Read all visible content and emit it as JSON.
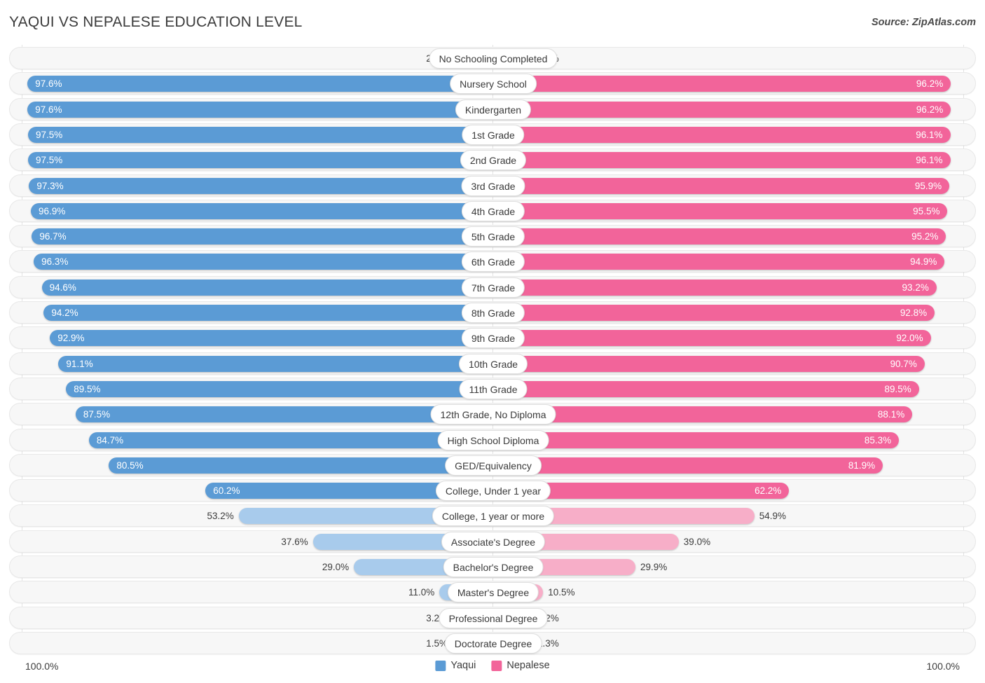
{
  "header": {
    "title": "YAQUI VS NEPALESE EDUCATION LEVEL",
    "source": "Source: ZipAtlas.com"
  },
  "axis": {
    "left_max_label": "100.0%",
    "right_max_label": "100.0%"
  },
  "legend": {
    "items": [
      {
        "label": "Yaqui",
        "color": "#5B9BD5"
      },
      {
        "label": "Nepalese",
        "color": "#F2649A"
      }
    ]
  },
  "colors": {
    "blue_strong": "#5B9BD5",
    "blue_light": "#A8CBEC",
    "pink_strong": "#F2649A",
    "pink_light": "#F7AEC8",
    "track": "#f7f7f7",
    "track_border": "#e8e8e8"
  },
  "chart_data": {
    "type": "bar",
    "orientation": "horizontal-diverging",
    "title": "YAQUI VS NEPALESE EDUCATION LEVEL",
    "xlabel": "",
    "ylabel": "",
    "xlim": [
      0,
      100
    ],
    "grid": false,
    "legend_position": "bottom-center",
    "categories": [
      "No Schooling Completed",
      "Nursery School",
      "Kindergarten",
      "1st Grade",
      "2nd Grade",
      "3rd Grade",
      "4th Grade",
      "5th Grade",
      "6th Grade",
      "7th Grade",
      "8th Grade",
      "9th Grade",
      "10th Grade",
      "11th Grade",
      "12th Grade, No Diploma",
      "High School Diploma",
      "GED/Equivalency",
      "College, Under 1 year",
      "College, 1 year or more",
      "Associate's Degree",
      "Bachelor's Degree",
      "Master's Degree",
      "Professional Degree",
      "Doctorate Degree"
    ],
    "series": [
      {
        "name": "Yaqui",
        "side": "left",
        "color": "#5B9BD5",
        "values": [
          2.4,
          97.6,
          97.6,
          97.5,
          97.5,
          97.3,
          96.9,
          96.7,
          96.3,
          94.6,
          94.2,
          92.9,
          91.1,
          89.5,
          87.5,
          84.7,
          80.5,
          60.2,
          53.2,
          37.6,
          29.0,
          11.0,
          3.2,
          1.5
        ],
        "labels": [
          "2.4%",
          "97.6%",
          "97.6%",
          "97.5%",
          "97.5%",
          "97.3%",
          "96.9%",
          "96.7%",
          "96.3%",
          "94.6%",
          "94.2%",
          "92.9%",
          "91.1%",
          "89.5%",
          "87.5%",
          "84.7%",
          "80.5%",
          "60.2%",
          "53.2%",
          "37.6%",
          "29.0%",
          "11.0%",
          "3.2%",
          "1.5%"
        ]
      },
      {
        "name": "Nepalese",
        "side": "right",
        "color": "#F2649A",
        "values": [
          3.8,
          96.2,
          96.2,
          96.1,
          96.1,
          95.9,
          95.5,
          95.2,
          94.9,
          93.2,
          92.8,
          92.0,
          90.7,
          89.5,
          88.1,
          85.3,
          81.9,
          62.2,
          54.9,
          39.0,
          29.9,
          10.5,
          3.2,
          1.3
        ],
        "labels": [
          "3.8%",
          "96.2%",
          "96.2%",
          "96.1%",
          "96.1%",
          "95.9%",
          "95.5%",
          "95.2%",
          "94.9%",
          "93.2%",
          "92.8%",
          "92.0%",
          "90.7%",
          "89.5%",
          "88.1%",
          "85.3%",
          "81.9%",
          "62.2%",
          "54.9%",
          "39.0%",
          "29.9%",
          "10.5%",
          "3.2%",
          "1.3%"
        ]
      }
    ]
  }
}
